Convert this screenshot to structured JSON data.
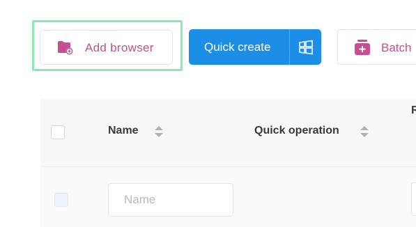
{
  "toolbar": {
    "add_browser_label": "Add browser",
    "quick_create_label": "Quick create",
    "batch_label": "Batch"
  },
  "table": {
    "columns": [
      "Name",
      "Quick operation",
      "R"
    ],
    "name_placeholder": "Name"
  },
  "colors": {
    "accent_pink": "#c64e91",
    "primary_blue": "#1d8ee6",
    "focus_green": "#8ee6b0"
  },
  "icons": {
    "add_browser": "folder-plus-icon",
    "quick_layout": "windows-grid-icon",
    "batch": "stack-plus-icon",
    "sort": "sort-arrows-icon"
  }
}
